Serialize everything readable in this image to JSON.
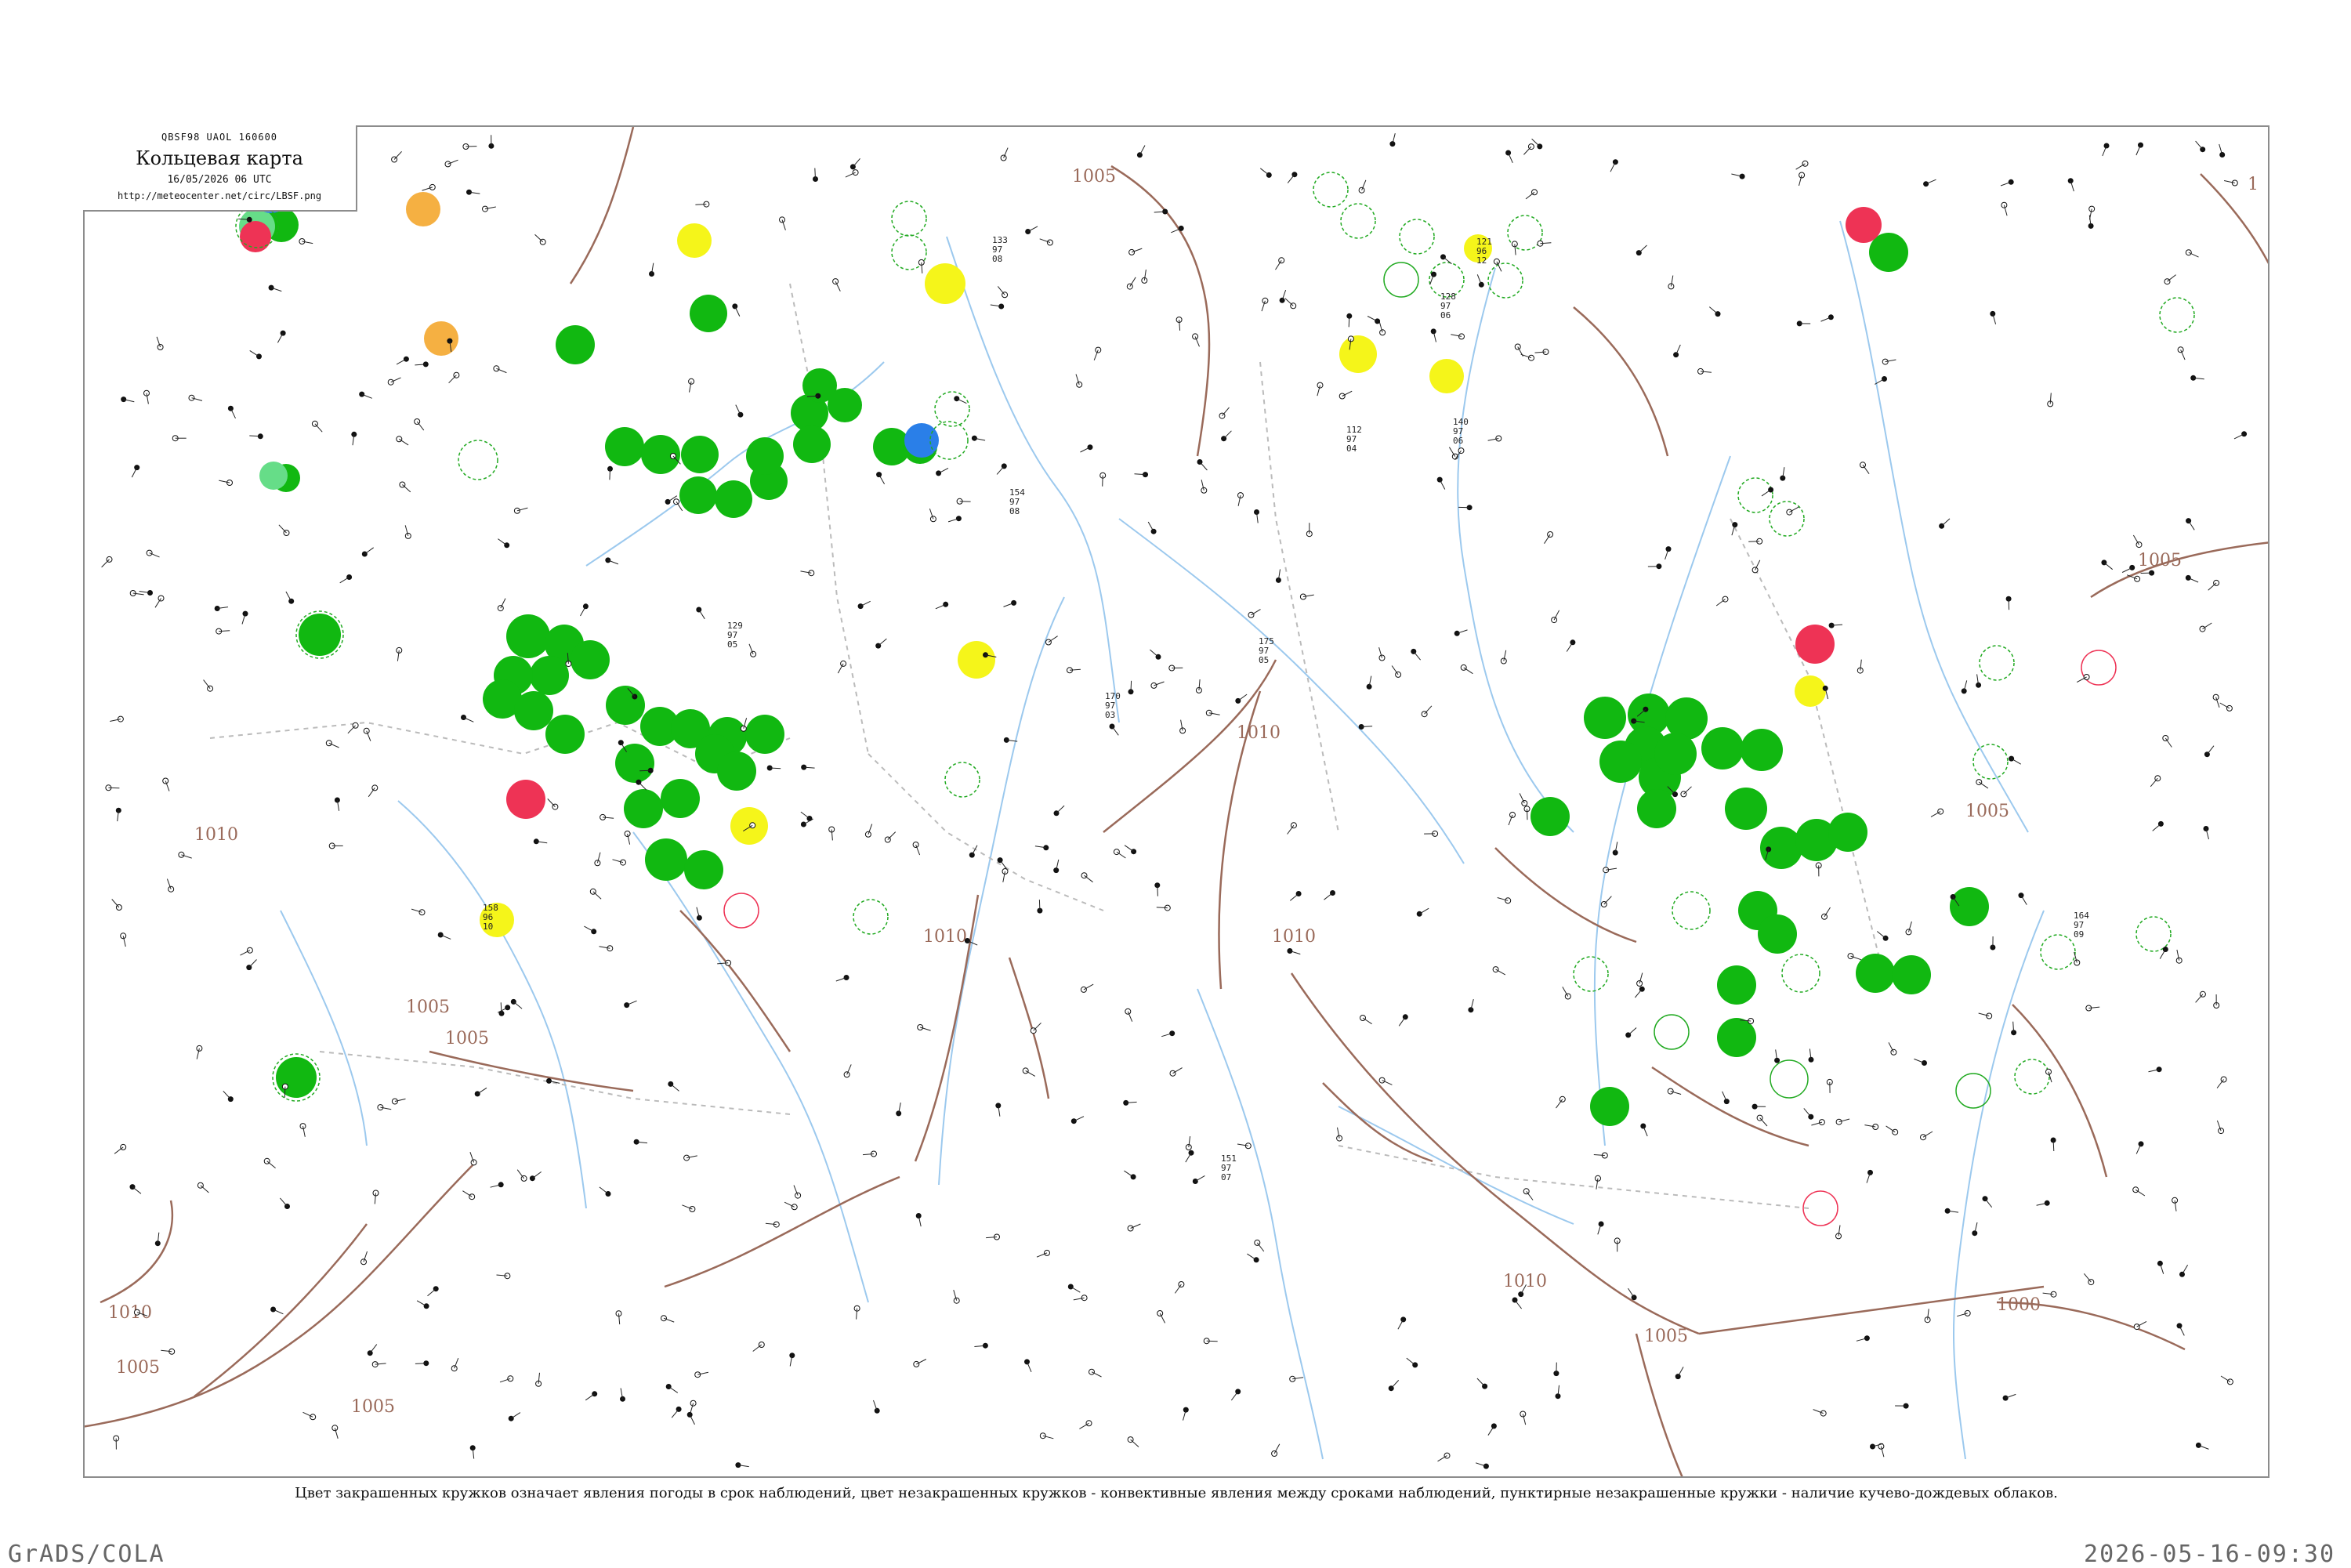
{
  "header": {
    "code": "QBSF98  UAOL  160600",
    "title": "Кольцевая карта",
    "date": "16/05/2026 06 UTC",
    "url": "http://meteocenter.net/circ/LBSF.png"
  },
  "caption": "Цвет закрашенных кружков означает явления погоды в срок наблюдений, цвет незакрашенных кружков - конвективные явления между сроками наблюдений, пунктирные незакрашенные кружки - наличие кучево-дождевых облаков.",
  "footer": {
    "software": "GrADS/COLA",
    "timestamp": "2026-05-16-09:30"
  },
  "colors": {
    "green": "#11b811",
    "red": "#ee3355",
    "yellow": "#f5f51a",
    "orange": "#f5b042",
    "blue": "#2a7fe8",
    "light_green": "#66dd88",
    "isobar": "#9a6a5a",
    "river": "#9cc9ee",
    "border": "#bbbbbb"
  },
  "isobars": [
    {
      "label": "1005"
    },
    {
      "label": "1005"
    },
    {
      "label": "1010"
    },
    {
      "label": "1010"
    },
    {
      "label": "1010"
    },
    {
      "label": "1010"
    },
    {
      "label": "1005"
    },
    {
      "label": "1010"
    },
    {
      "label": "1005"
    },
    {
      "label": "1005"
    },
    {
      "label": "1000"
    },
    {
      "label": "1005"
    },
    {
      "label": "1010"
    },
    {
      "label": "1005"
    },
    {
      "label": "1005"
    },
    {
      "label": "1"
    }
  ],
  "station_samples": [
    {
      "p": "133",
      "t": "97",
      "d": "08"
    },
    {
      "p": "175",
      "t": "97",
      "d": "05"
    },
    {
      "p": "129",
      "t": "97",
      "d": "05"
    },
    {
      "p": "154",
      "t": "97",
      "d": "08"
    },
    {
      "p": "151",
      "t": "97",
      "d": "07"
    },
    {
      "p": "170",
      "t": "97",
      "d": "03"
    },
    {
      "p": "164",
      "t": "97",
      "d": "09"
    },
    {
      "p": "158",
      "t": "96",
      "d": "10"
    },
    {
      "p": "112",
      "t": "97",
      "d": "04"
    },
    {
      "p": "140",
      "t": "97",
      "d": "06"
    },
    {
      "p": "121",
      "t": "96",
      "d": "12"
    },
    {
      "p": "128",
      "t": "97",
      "d": "06"
    }
  ]
}
